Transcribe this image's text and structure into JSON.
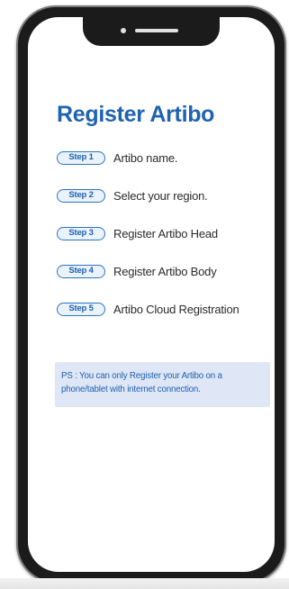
{
  "screen": {
    "title": "Register Artibo",
    "steps": [
      {
        "badge": "Step 1",
        "label": "Artibo name."
      },
      {
        "badge": "Step 2",
        "label": "Select your region."
      },
      {
        "badge": "Step 3",
        "label": "Register Artibo Head"
      },
      {
        "badge": "Step 4",
        "label": "Register Artibo Body"
      },
      {
        "badge": "Step 5",
        "label": "Artibo Cloud Registration"
      }
    ],
    "note": "PS : You can only Register  your Artibo on a phone/tablet with internet connection."
  },
  "colors": {
    "accent": "#1f63b0",
    "badge_border": "#2f74c0",
    "badge_fill": "#eaf2fb",
    "note_background": "#dfe6f5",
    "phone_frame": "#1b1b1b",
    "text": "#2b2b2b"
  }
}
